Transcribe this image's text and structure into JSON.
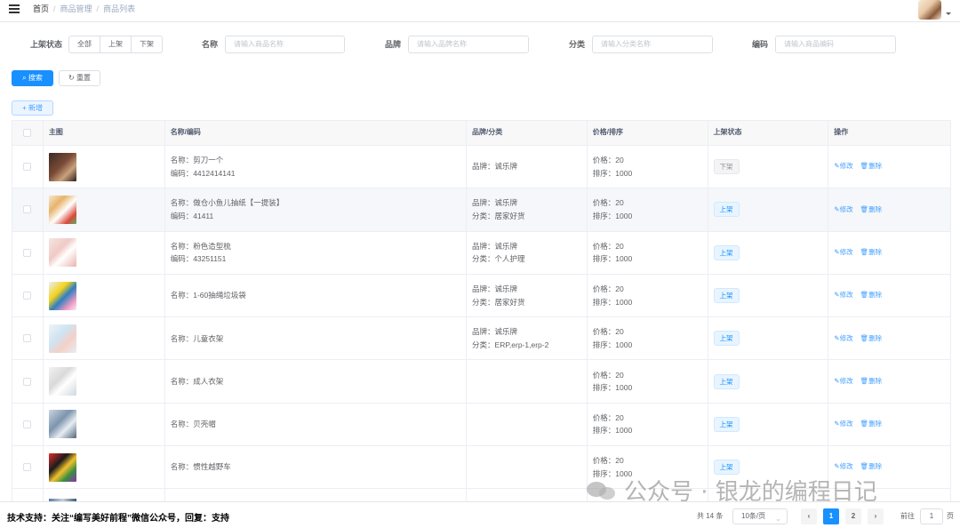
{
  "breadcrumb": [
    "首页",
    "商品管理",
    "商品列表"
  ],
  "filters": {
    "status_label": "上架状态",
    "status_options": [
      "全部",
      "上架",
      "下架"
    ],
    "name_label": "名称",
    "name_placeholder": "请输入商品名称",
    "brand_label": "品牌",
    "brand_placeholder": "请输入品牌名称",
    "category_label": "分类",
    "category_placeholder": "请输入分类名称",
    "code_label": "编码",
    "code_placeholder": "请输入商品编码"
  },
  "buttons": {
    "search": "搜索",
    "reset": "重置",
    "add": "新增"
  },
  "table": {
    "headers": [
      "主图",
      "名称/编码",
      "品牌/分类",
      "价格/排序",
      "上架状态",
      "操作"
    ],
    "rows": [
      {
        "name": "名称：剪刀一个",
        "code": "编码：4412414141",
        "brand": "品牌：诚乐牌",
        "category": "",
        "price": "价格：20",
        "sort": "排序：1000",
        "status": "下架",
        "status_on": false
      },
      {
        "name": "名称：做仓小鱼儿抽纸【一提装】",
        "code": "编码：41411",
        "brand": "品牌：诚乐牌",
        "category": "分类：居家好货",
        "price": "价格：20",
        "sort": "排序：1000",
        "status": "上架",
        "status_on": true
      },
      {
        "name": "名称：粉色造型梳",
        "code": "编码：43251151",
        "brand": "品牌：诚乐牌",
        "category": "分类：个人护理",
        "price": "价格：20",
        "sort": "排序：1000",
        "status": "上架",
        "status_on": true
      },
      {
        "name": "名称：1-60抽绳垃圾袋",
        "code": "",
        "brand": "品牌：诚乐牌",
        "category": "分类：居家好货",
        "price": "价格：20",
        "sort": "排序：1000",
        "status": "上架",
        "status_on": true
      },
      {
        "name": "名称：儿童衣架",
        "code": "",
        "brand": "品牌：诚乐牌",
        "category": "分类：ERP,erp-1,erp-2",
        "price": "价格：20",
        "sort": "排序：1000",
        "status": "上架",
        "status_on": true
      },
      {
        "name": "名称：成人衣架",
        "code": "",
        "brand": "",
        "category": "",
        "price": "价格：20",
        "sort": "排序：1000",
        "status": "上架",
        "status_on": true
      },
      {
        "name": "名称：贝壳帽",
        "code": "",
        "brand": "",
        "category": "",
        "price": "价格：20",
        "sort": "排序：1000",
        "status": "上架",
        "status_on": true
      },
      {
        "name": "名称：惯性越野车",
        "code": "",
        "brand": "",
        "category": "",
        "price": "价格：20",
        "sort": "排序：1000",
        "status": "上架",
        "status_on": true
      }
    ],
    "edit_label": "修改",
    "delete_label": "删除"
  },
  "footer": {
    "support_text": "技术支持：关注“编写美好前程”微信公众号，回复：支持",
    "total": "共 14 条",
    "page_size": "10条/页",
    "pages": [
      "1",
      "2"
    ],
    "goto_label": "前往",
    "goto_value": "1",
    "goto_unit": "页"
  },
  "watermark": "公众号 · 银龙的编程日记",
  "colors": {
    "primary": "#1890ff",
    "link": "#409eff",
    "border": "#dcdfe6"
  }
}
